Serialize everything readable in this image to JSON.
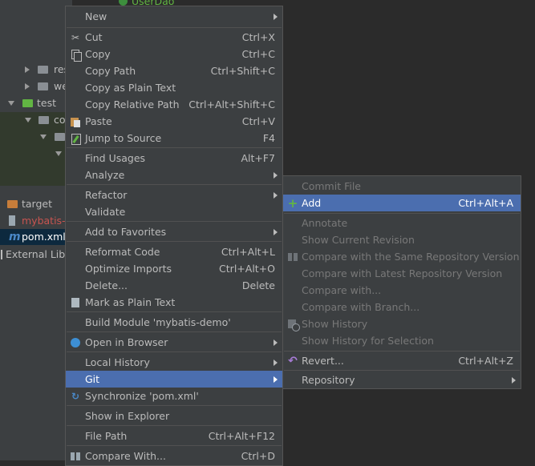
{
  "tree": {
    "top_class": "UserDao",
    "items": [
      {
        "label": "res",
        "icon": "folder-resources"
      },
      {
        "label": "we",
        "icon": "folder-webapp"
      },
      {
        "label": "test",
        "icon": "folder-test"
      },
      {
        "label": "co",
        "icon": "folder-package"
      },
      {
        "label": "target",
        "icon": "folder-target"
      },
      {
        "label": "mybatis-d",
        "icon": "file-iml"
      },
      {
        "label": "pom.xml",
        "icon": "maven-icon"
      },
      {
        "label": "External Libra",
        "icon": "library-icon"
      }
    ]
  },
  "menu": {
    "items": [
      {
        "label": "New",
        "shortcut": ""
      },
      {
        "label": "Cut",
        "shortcut": "Ctrl+X"
      },
      {
        "label": "Copy",
        "shortcut": "Ctrl+C"
      },
      {
        "label": "Copy Path",
        "shortcut": "Ctrl+Shift+C"
      },
      {
        "label": "Copy as Plain Text",
        "shortcut": ""
      },
      {
        "label": "Copy Relative Path",
        "shortcut": "Ctrl+Alt+Shift+C"
      },
      {
        "label": "Paste",
        "shortcut": "Ctrl+V"
      },
      {
        "label": "Jump to Source",
        "shortcut": "F4"
      },
      {
        "label": "Find Usages",
        "shortcut": "Alt+F7"
      },
      {
        "label": "Analyze",
        "shortcut": ""
      },
      {
        "label": "Refactor",
        "shortcut": ""
      },
      {
        "label": "Validate",
        "shortcut": ""
      },
      {
        "label": "Add to Favorites",
        "shortcut": ""
      },
      {
        "label": "Reformat Code",
        "shortcut": "Ctrl+Alt+L"
      },
      {
        "label": "Optimize Imports",
        "shortcut": "Ctrl+Alt+O"
      },
      {
        "label": "Delete...",
        "shortcut": "Delete"
      },
      {
        "label": "Mark as Plain Text",
        "shortcut": ""
      },
      {
        "label": "Build Module 'mybatis-demo'",
        "shortcut": ""
      },
      {
        "label": "Open in Browser",
        "shortcut": ""
      },
      {
        "label": "Local History",
        "shortcut": ""
      },
      {
        "label": "Git",
        "shortcut": ""
      },
      {
        "label": "Synchronize 'pom.xml'",
        "shortcut": ""
      },
      {
        "label": "Show in Explorer",
        "shortcut": ""
      },
      {
        "label": "File Path",
        "shortcut": "Ctrl+Alt+F12"
      },
      {
        "label": "Compare With...",
        "shortcut": "Ctrl+D"
      }
    ]
  },
  "git_menu": {
    "items": [
      {
        "label": "Commit File",
        "shortcut": ""
      },
      {
        "label": "Add",
        "shortcut": "Ctrl+Alt+A"
      },
      {
        "label": "Annotate",
        "shortcut": ""
      },
      {
        "label": "Show Current Revision",
        "shortcut": ""
      },
      {
        "label": "Compare with the Same Repository Version",
        "shortcut": ""
      },
      {
        "label": "Compare with Latest Repository Version",
        "shortcut": ""
      },
      {
        "label": "Compare with...",
        "shortcut": ""
      },
      {
        "label": "Compare with Branch...",
        "shortcut": ""
      },
      {
        "label": "Show History",
        "shortcut": ""
      },
      {
        "label": "Show History for Selection",
        "shortcut": ""
      },
      {
        "label": "Revert...",
        "shortcut": "Ctrl+Alt+Z"
      },
      {
        "label": "Repository",
        "shortcut": ""
      }
    ]
  },
  "colors": {
    "highlight": "#4b6eaf",
    "menu_bg": "#3c3f41",
    "tree_bg": "#3c3f41",
    "pom_outline": "#d03b3b"
  }
}
